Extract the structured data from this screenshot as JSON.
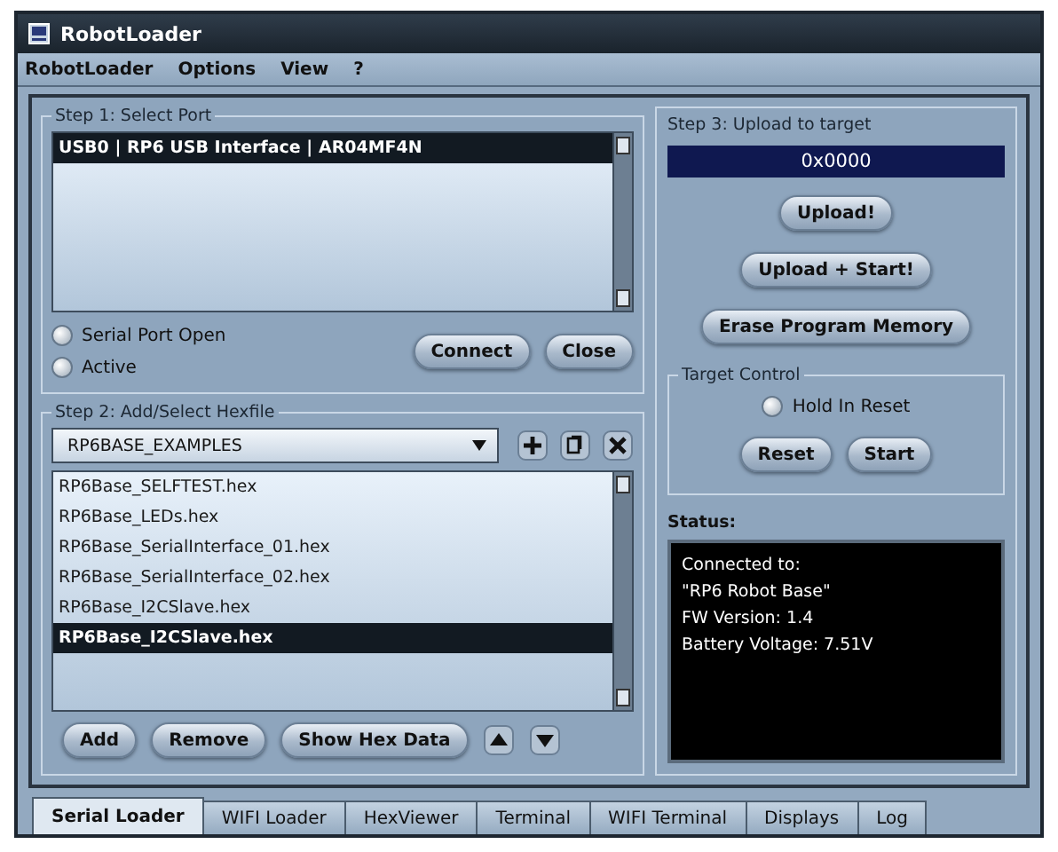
{
  "window": {
    "title": "RobotLoader"
  },
  "menu": [
    "RobotLoader",
    "Options",
    "View",
    "?"
  ],
  "step1": {
    "title": "Step 1: Select Port",
    "ports": [
      {
        "label": "USB0 | RP6 USB Interface | AR04MF4N",
        "selected": true
      }
    ],
    "radios": [
      {
        "label": "Serial Port Open",
        "checked": false
      },
      {
        "label": "Active",
        "checked": false
      }
    ],
    "buttons": [
      "Connect",
      "Close"
    ]
  },
  "step2": {
    "title": "Step 2: Add/Select Hexfile",
    "category": "RP6BASE_EXAMPLES",
    "tools": [
      {
        "kind": "add"
      },
      {
        "kind": "copy"
      },
      {
        "kind": "delete"
      }
    ],
    "files": [
      {
        "label": "RP6Base_SELFTEST.hex",
        "selected": false
      },
      {
        "label": "RP6Base_LEDs.hex",
        "selected": false
      },
      {
        "label": "RP6Base_SerialInterface_01.hex",
        "selected": false
      },
      {
        "label": "RP6Base_SerialInterface_02.hex",
        "selected": false
      },
      {
        "label": "RP6Base_I2CSlave.hex",
        "selected": false
      },
      {
        "label": "RP6Base_I2CSlave.hex",
        "selected": true
      }
    ],
    "buttons": [
      "Add",
      "Remove",
      "Show Hex Data"
    ],
    "arrows": [
      {
        "kind": "up"
      },
      {
        "kind": "down"
      }
    ]
  },
  "step3": {
    "title": "Step 3: Upload to target",
    "address": "0x0000",
    "buttons": [
      "Upload!",
      "Upload + Start!",
      "Erase Program Memory"
    ]
  },
  "target_control": {
    "title": "Target Control",
    "radio": {
      "label": "Hold In Reset",
      "checked": false
    },
    "buttons": [
      "Reset",
      "Start"
    ]
  },
  "status": {
    "title": "Status:",
    "lines": [
      "Connected to:",
      "\"RP6 Robot Base\"",
      "FW Version: 1.4",
      "Battery Voltage: 7.51V"
    ]
  },
  "tabs": [
    {
      "label": "Serial Loader",
      "selected": true
    },
    {
      "label": "WIFI Loader",
      "selected": false
    },
    {
      "label": "HexViewer",
      "selected": false
    },
    {
      "label": "Terminal",
      "selected": false
    },
    {
      "label": "WIFI Terminal",
      "selected": false
    },
    {
      "label": "Displays",
      "selected": false
    },
    {
      "label": "Log",
      "selected": false
    }
  ]
}
